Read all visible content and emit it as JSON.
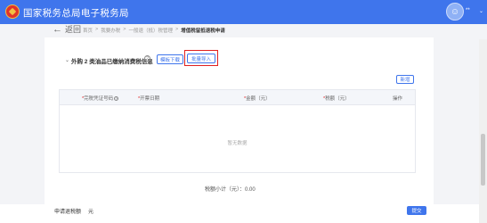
{
  "header": {
    "title": "国家税务总局电子税务局",
    "user_name": "**",
    "user_caret": "⌄"
  },
  "nav": {
    "back_label": "返回",
    "back_arrow": "←",
    "breadcrumb": [
      "首页",
      ">",
      "我要办税",
      ">",
      "一般退（抵）税管理",
      ">"
    ],
    "breadcrumb_current": "增值税留抵退税申请"
  },
  "section": {
    "caret": "⌄",
    "title": "外购 2 类油品已缴纳消费税信息",
    "help": "?",
    "template_download": "模板下载",
    "batch_import": "批量导入",
    "add": "新增"
  },
  "table": {
    "columns": [
      {
        "label": "完税凭证号码",
        "required": "*",
        "help": "?"
      },
      {
        "label": "开票日期",
        "required": "*"
      },
      {
        "label": "金额（元）",
        "required": "*"
      },
      {
        "label": "税额（元）",
        "required": "*"
      },
      {
        "label": "操作",
        "required": ""
      }
    ],
    "empty_text": "暂无数据"
  },
  "summary": {
    "total": "税额小计（元）：0.00"
  },
  "footer": {
    "apply_label": "申请退税额",
    "apply_value": "元",
    "submit": "提交"
  },
  "colors": {
    "brand": "#3f75ec",
    "highlight": "#e02020"
  }
}
